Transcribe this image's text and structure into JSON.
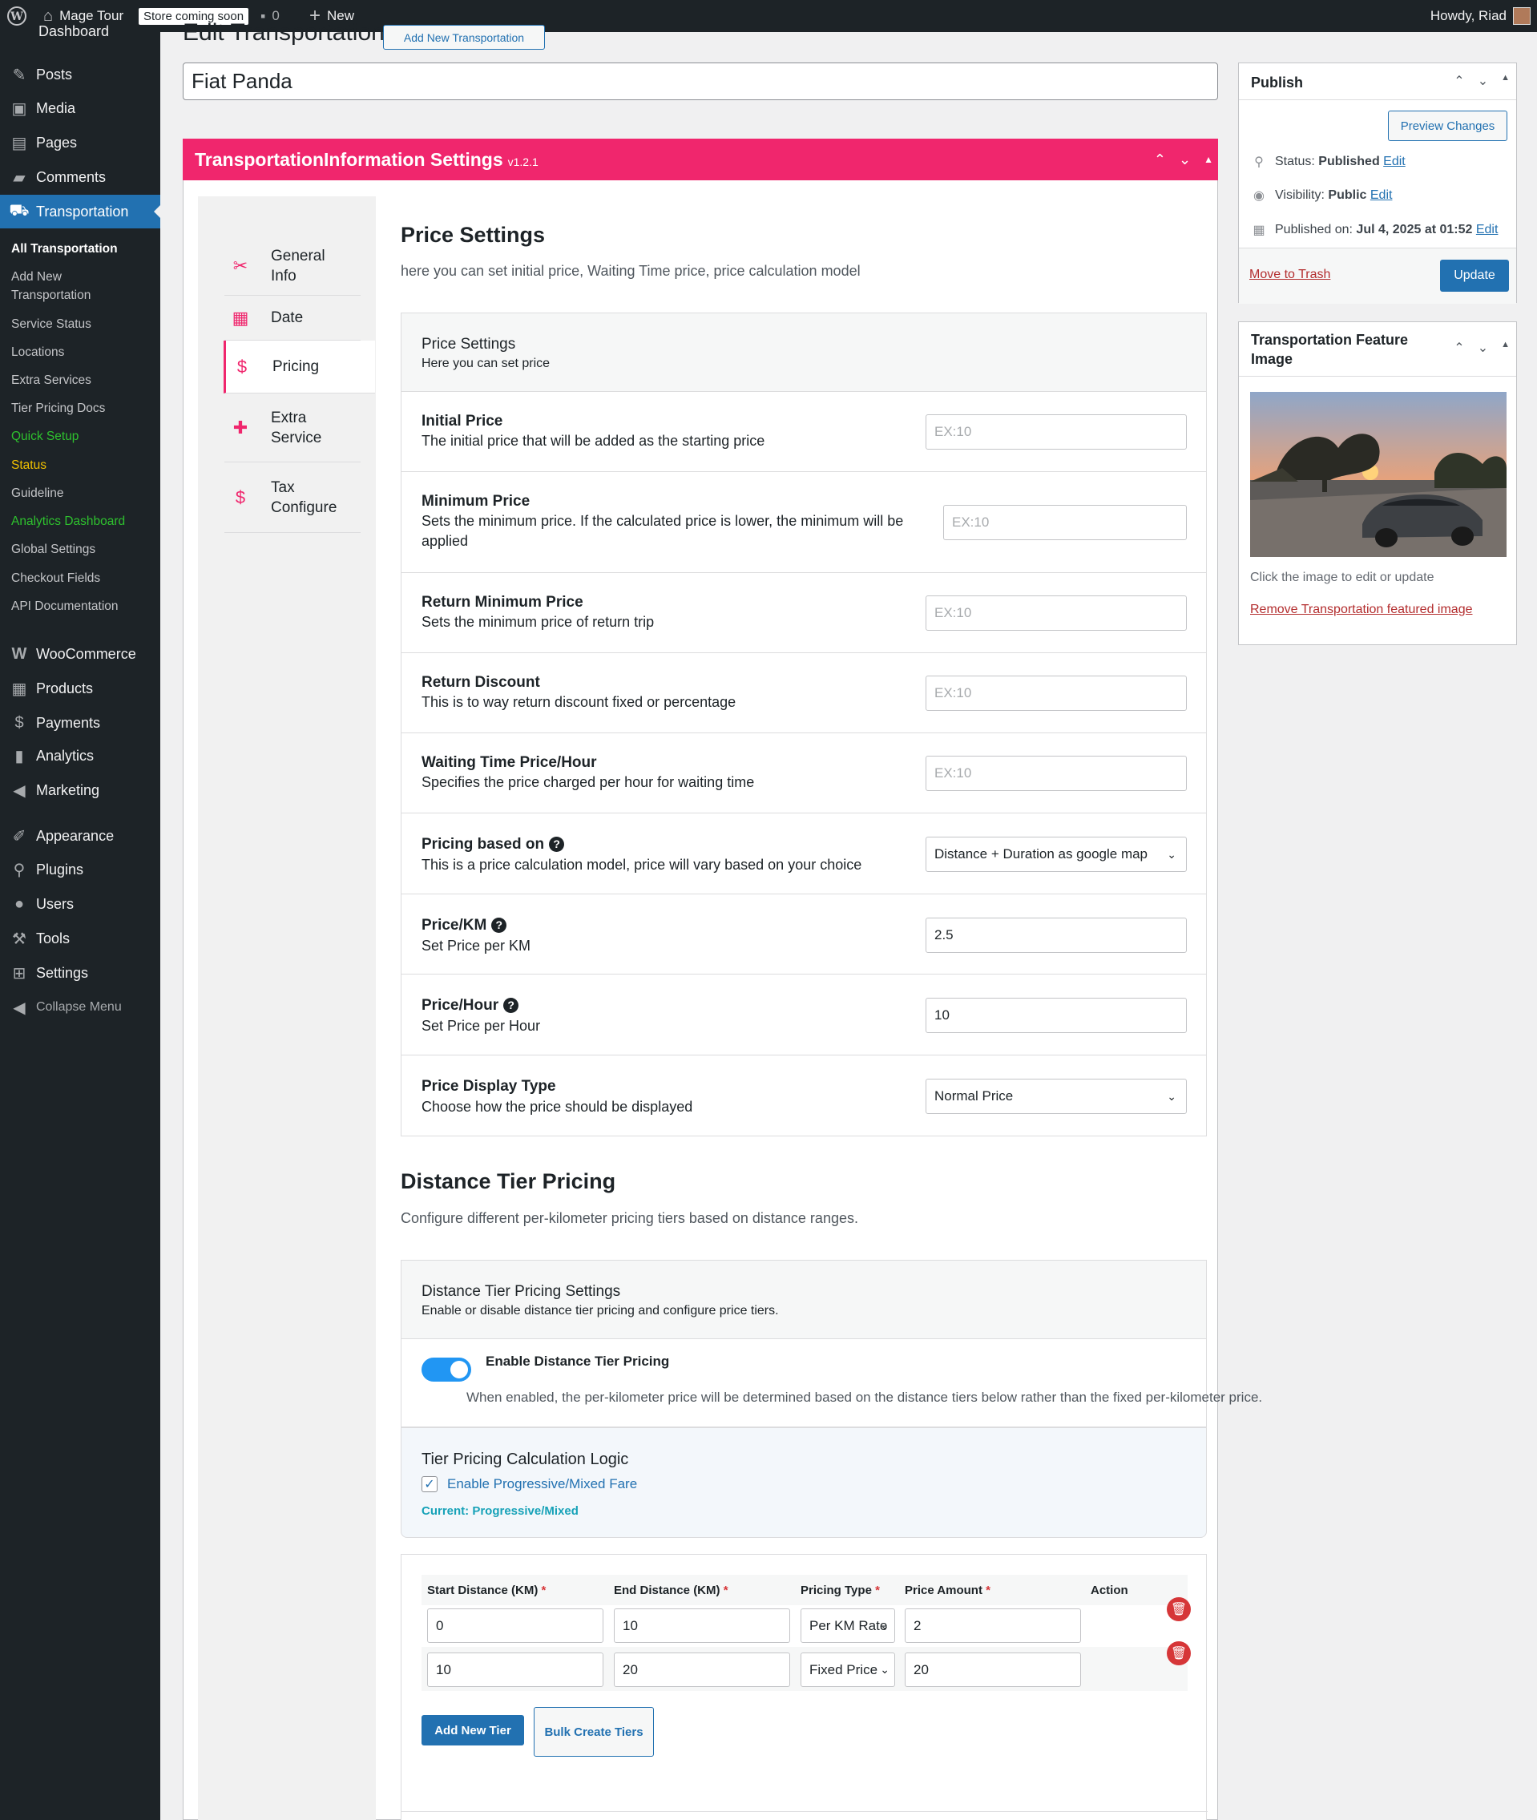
{
  "admin_bar": {
    "site_name": "Mage Tour",
    "store_badge": "Store coming soon",
    "comments_count": "0",
    "new_label": "New",
    "howdy": "Howdy, Riad"
  },
  "sidebar": {
    "partial_top": "Dashboard",
    "items_top": [
      {
        "label": "Posts",
        "icon": "pin-icon"
      },
      {
        "label": "Media",
        "icon": "media-icon"
      },
      {
        "label": "Pages",
        "icon": "pages-icon"
      },
      {
        "label": "Comments",
        "icon": "comment-icon"
      },
      {
        "label": "Transportation",
        "icon": "car-icon"
      }
    ],
    "submenu": [
      "All Transportation",
      "Add New Transportation",
      "Service Status",
      "Locations",
      "Extra Services",
      "Tier Pricing Docs",
      "Quick Setup",
      "Status",
      "Guideline",
      "Analytics Dashboard",
      "Global Settings",
      "Checkout Fields",
      "API Documentation"
    ],
    "items_bottom": [
      {
        "label": "WooCommerce",
        "icon": "woo-icon"
      },
      {
        "label": "Products",
        "icon": "products-icon"
      },
      {
        "label": "Payments",
        "icon": "payments-icon"
      },
      {
        "label": "Analytics",
        "icon": "analytics-icon"
      },
      {
        "label": "Marketing",
        "icon": "megaphone-icon"
      },
      {
        "label": "Appearance",
        "icon": "brush-icon"
      },
      {
        "label": "Plugins",
        "icon": "plugin-icon"
      },
      {
        "label": "Users",
        "icon": "users-icon"
      },
      {
        "label": "Tools",
        "icon": "wrench-icon"
      },
      {
        "label": "Settings",
        "icon": "settings-icon"
      },
      {
        "label": "Collapse Menu",
        "icon": "collapse-icon"
      }
    ]
  },
  "page": {
    "heading": "Edit Transportation",
    "add_new_button": "Add New Transportation",
    "post_title": "Fiat Panda"
  },
  "settings": {
    "title": "TransportationInformation Settings",
    "version": "v1.2.1",
    "tabs": [
      {
        "label": "General Info",
        "icon": "tools-icon"
      },
      {
        "label": "Date",
        "icon": "calendar-icon"
      },
      {
        "label": "Pricing",
        "icon": "hand-money-icon"
      },
      {
        "label": "Extra Service",
        "icon": "puzzle-icon"
      },
      {
        "label": "Tax Configure",
        "icon": "hand-money-icon"
      }
    ],
    "price_section": {
      "title": "Price Settings",
      "description": "here you can set initial price, Waiting Time price, price calculation model",
      "box_title": "Price Settings",
      "box_subtitle": "Here you can set price",
      "rows": [
        {
          "label": "Initial Price",
          "desc": "The initial price that will be added as the starting price",
          "placeholder": "EX:10",
          "value": ""
        },
        {
          "label": "Minimum Price",
          "desc": "Sets the minimum price. If the calculated price is lower, the minimum will be applied",
          "placeholder": "EX:10",
          "value": ""
        },
        {
          "label": "Return Minimum Price",
          "desc": "Sets the minimum price of return trip",
          "placeholder": "EX:10",
          "value": ""
        },
        {
          "label": "Return Discount",
          "desc": "This is to way return discount fixed or percentage",
          "placeholder": "EX:10",
          "value": ""
        },
        {
          "label": "Waiting Time Price/Hour",
          "desc": "Specifies the price charged per hour for waiting time",
          "placeholder": "EX:10",
          "value": ""
        },
        {
          "label": "Pricing based on",
          "desc": "This is a price calculation model, price will vary based on your choice",
          "value": "Distance + Duration as google map"
        },
        {
          "label": "Price/KM",
          "desc": "Set Price per KM",
          "value": "2.5"
        },
        {
          "label": "Price/Hour",
          "desc": "Set Price per Hour",
          "value": "10"
        },
        {
          "label": "Price Display Type",
          "desc": "Choose how the price should be displayed",
          "value": "Normal Price"
        }
      ]
    },
    "tier_section": {
      "title": "Distance Tier Pricing",
      "description": "Configure different per-kilometer pricing tiers based on distance ranges.",
      "box_title": "Distance Tier Pricing Settings",
      "box_subtitle": "Enable or disable distance tier pricing and configure price tiers.",
      "toggle_label": "Enable Distance Tier Pricing",
      "toggle_on": true,
      "toggle_desc": "When enabled, the per-kilometer price will be determined based on the distance tiers below rather than the fixed per-kilometer price.",
      "logic_title": "Tier Pricing Calculation Logic",
      "logic_checkbox": "Enable Progressive/Mixed Fare",
      "logic_checked": true,
      "logic_current": "Current: Progressive/Mixed",
      "table_headers": [
        "Start Distance (KM)",
        "End Distance (KM)",
        "Pricing Type",
        "Price Amount",
        "Action"
      ],
      "required_marker": "*",
      "tiers": [
        {
          "start": "0",
          "end": "10",
          "type": "Per KM Rate",
          "amount": "2"
        },
        {
          "start": "10",
          "end": "20",
          "type": "Fixed Price",
          "amount": "20"
        }
      ],
      "add_tier_button": "Add New Tier",
      "bulk_button": "Bulk Create Tiers"
    }
  },
  "publish": {
    "title": "Publish",
    "preview_button": "Preview Changes",
    "status_label": "Status:",
    "status_value": "Published",
    "visibility_label": "Visibility:",
    "visibility_value": "Public",
    "published_label": "Published on:",
    "published_value": "Jul 4, 2025 at 01:52",
    "edit_link": "Edit",
    "trash_link": "Move to Trash",
    "update_button": "Update"
  },
  "feature_image": {
    "title": "Transportation Feature Image",
    "hint": "Click the image to edit or update",
    "remove_link": "Remove Transportation featured image"
  },
  "colors": {
    "accent_pink": "#f0266d",
    "wp_blue": "#2271b1",
    "admin_dark": "#1d2327",
    "toggle_blue": "#2196f3"
  }
}
